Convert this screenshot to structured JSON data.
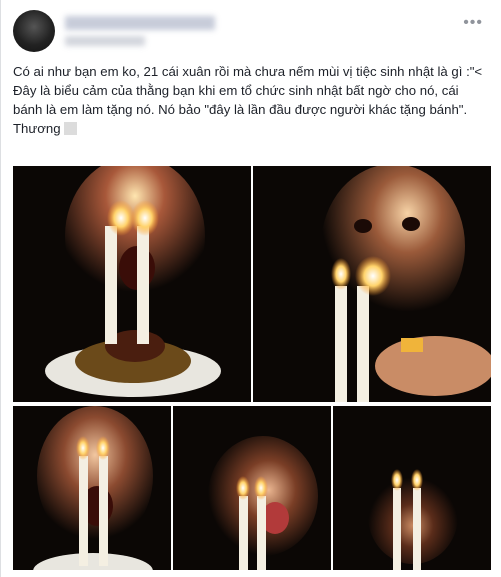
{
  "post": {
    "line1": "Có ai như bạn em ko, 21 cái xuân rồi mà chưa nếm mùi vị tiệc sinh nhật là gì :\"<",
    "line2": "Đây là biểu cảm của thằng bạn khi em tổ chức sinh nhật bất ngờ cho nó, cái bánh là em làm tặng nó. Nó bảo \"đây là lần đầu được người khác tặng bánh\". Thương"
  },
  "icons": {
    "more": "more-options-icon",
    "emoji": "emoji-icon"
  },
  "colors": {
    "text": "#1d2129",
    "meta": "#90949c",
    "flame": "#ffd36b",
    "background_dark": "#0b0705"
  }
}
